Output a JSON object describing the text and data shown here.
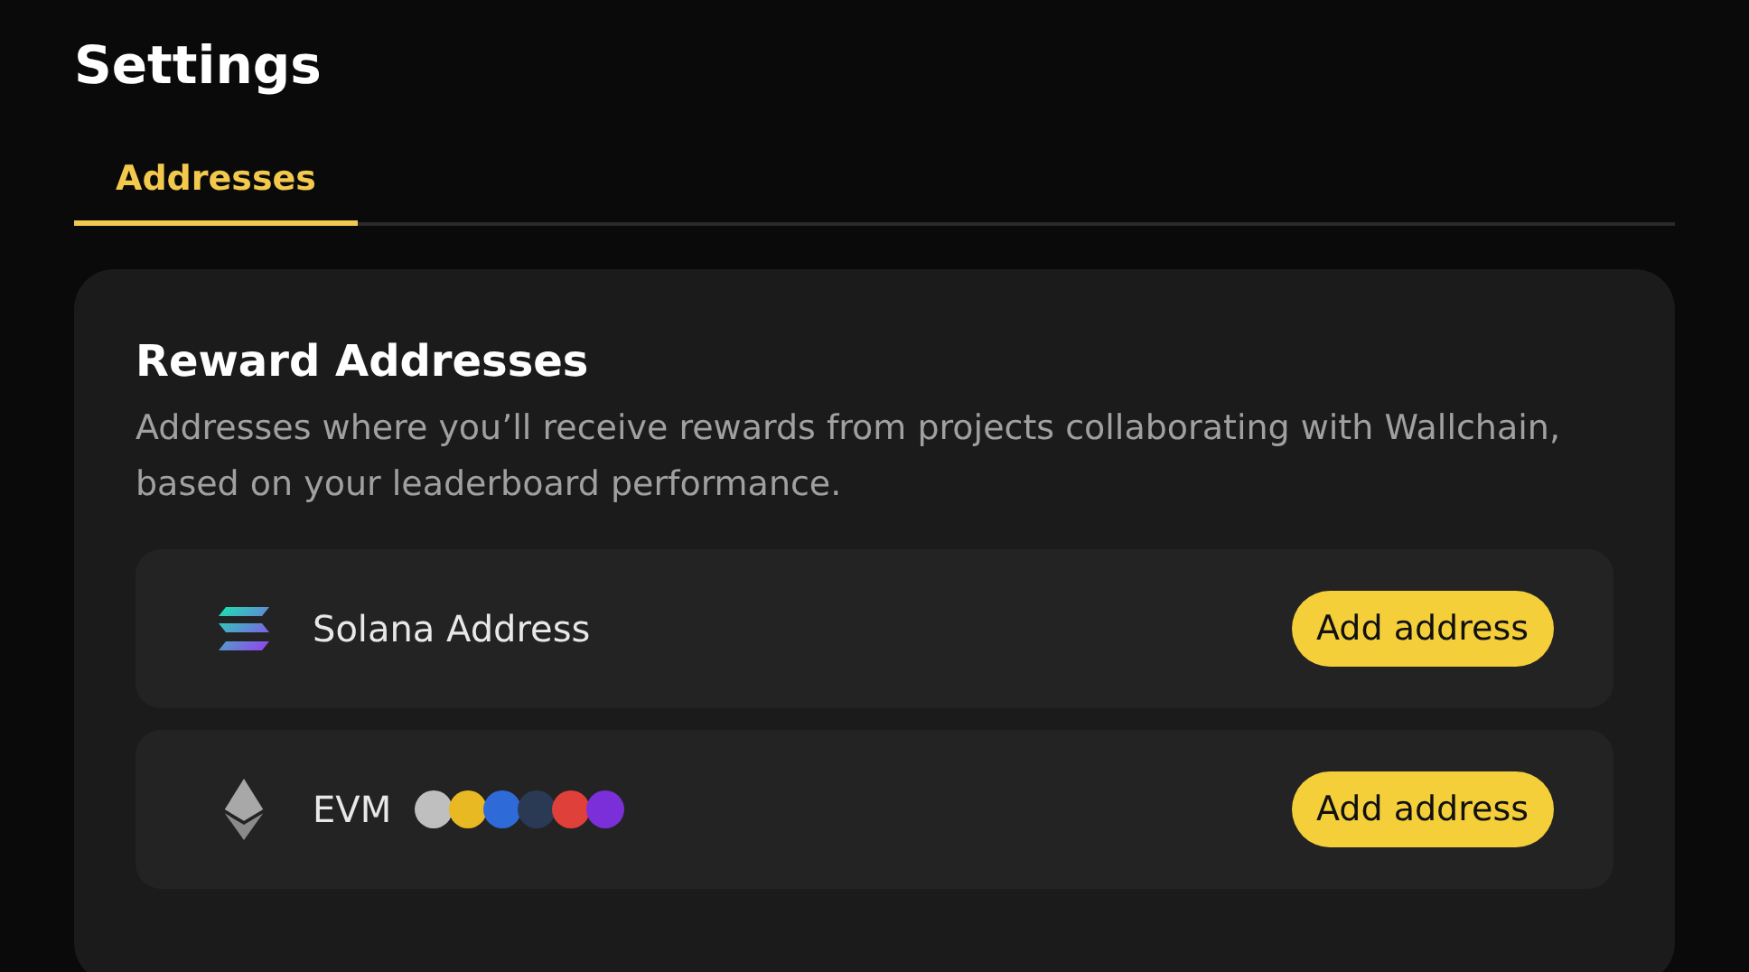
{
  "title": "Settings",
  "tabs": [
    {
      "label": "Addresses",
      "selected": true
    }
  ],
  "section": {
    "heading": "Reward Addresses",
    "description": "Addresses where you’ll receive rewards from projects collaborating with Wallchain, based on your leaderboard performance.",
    "rows": [
      {
        "kind": "solana",
        "label": "Solana Address",
        "button": "Add address"
      },
      {
        "kind": "evm",
        "label": "EVM",
        "button": "Add address"
      }
    ]
  }
}
